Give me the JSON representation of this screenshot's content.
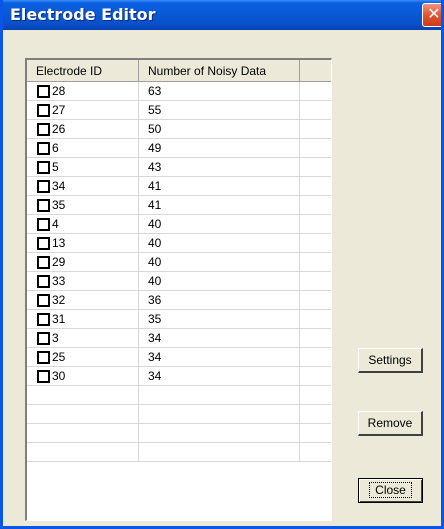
{
  "window": {
    "title": "Electrode Editor"
  },
  "list": {
    "columns": [
      "Electrode ID",
      "Number of Noisy Data",
      ""
    ],
    "rows": [
      {
        "id": "28",
        "noisy": "63"
      },
      {
        "id": "27",
        "noisy": "55"
      },
      {
        "id": "26",
        "noisy": "50"
      },
      {
        "id": "6",
        "noisy": "49"
      },
      {
        "id": "5",
        "noisy": "43"
      },
      {
        "id": "34",
        "noisy": "41"
      },
      {
        "id": "35",
        "noisy": "41"
      },
      {
        "id": "4",
        "noisy": "40"
      },
      {
        "id": "13",
        "noisy": "40"
      },
      {
        "id": "29",
        "noisy": "40"
      },
      {
        "id": "33",
        "noisy": "40"
      },
      {
        "id": "32",
        "noisy": "36"
      },
      {
        "id": "31",
        "noisy": "35"
      },
      {
        "id": "3",
        "noisy": "34"
      },
      {
        "id": "25",
        "noisy": "34"
      },
      {
        "id": "30",
        "noisy": "34"
      }
    ]
  },
  "buttons": {
    "settings": "Settings",
    "remove": "Remove",
    "close": "Close"
  }
}
